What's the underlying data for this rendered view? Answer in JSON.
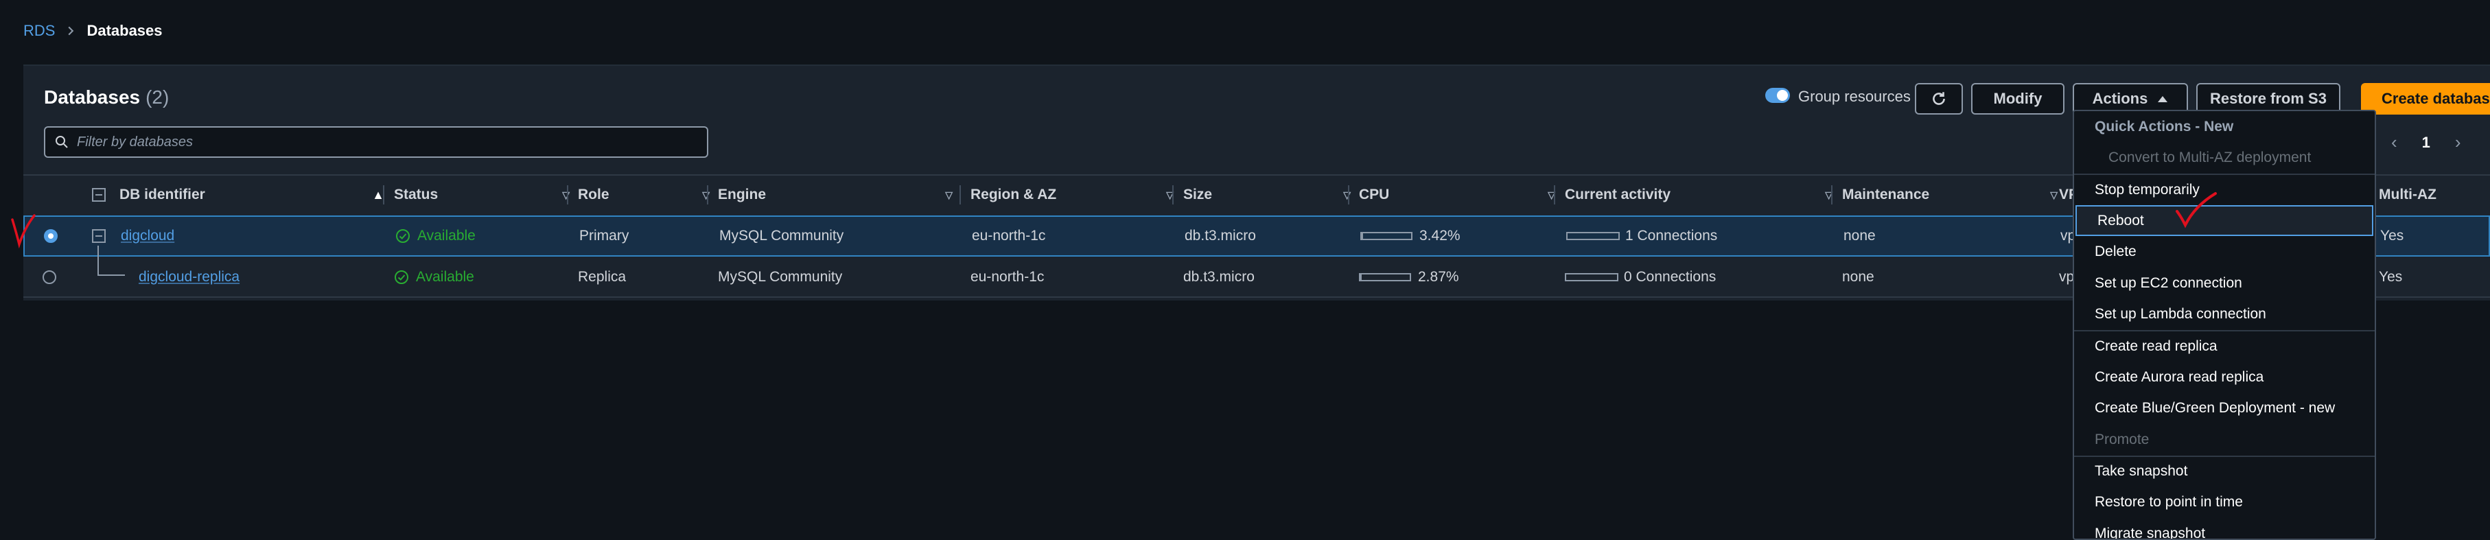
{
  "breadcrumb": {
    "root": "RDS",
    "current": "Databases"
  },
  "panel": {
    "title": "Databases",
    "count": "(2)"
  },
  "toolbar": {
    "group_resources_label": "Group resources",
    "modify_label": "Modify",
    "actions_label": "Actions",
    "restore_label": "Restore from S3",
    "create_label": "Create database"
  },
  "filter": {
    "placeholder": "Filter by databases"
  },
  "pager": {
    "page": "1"
  },
  "table": {
    "headers": {
      "db_identifier": "DB identifier",
      "status": "Status",
      "role": "Role",
      "engine": "Engine",
      "region": "Region & AZ",
      "size": "Size",
      "cpu": "CPU",
      "activity": "Current activity",
      "maintenance": "Maintenance",
      "vpc": "VP",
      "multi_az": "Multi-AZ"
    },
    "rows": [
      {
        "id": "digcloud",
        "status": "Available",
        "role": "Primary",
        "engine": "MySQL Community",
        "region": "eu-north-1c",
        "size": "db.t3.micro",
        "cpu": "3.42%",
        "cpu_fraction": 0.0342,
        "activity": "1 Connections",
        "maintenance": "none",
        "vpc": "vp",
        "multi_az": "Yes"
      },
      {
        "id": "digcloud-replica",
        "status": "Available",
        "role": "Replica",
        "engine": "MySQL Community",
        "region": "eu-north-1c",
        "size": "db.t3.micro",
        "cpu": "2.87%",
        "cpu_fraction": 0.0287,
        "activity": "0 Connections",
        "maintenance": "none",
        "vpc": "vp",
        "multi_az": "Yes"
      }
    ]
  },
  "menu": {
    "heading": "Quick Actions - New",
    "items": [
      "Convert to Multi-AZ deployment",
      "Stop temporarily",
      "Reboot",
      "Delete",
      "Set up EC2 connection",
      "Set up Lambda connection",
      "Create read replica",
      "Create Aurora read replica",
      "Create Blue/Green Deployment - new",
      "Promote",
      "Take snapshot",
      "Restore to point in time",
      "Migrate snapshot"
    ]
  },
  "colors": {
    "accent": "#539fe5",
    "primary_button": "#ff9900",
    "success": "#29ad32",
    "annotation": "#e0101e"
  }
}
